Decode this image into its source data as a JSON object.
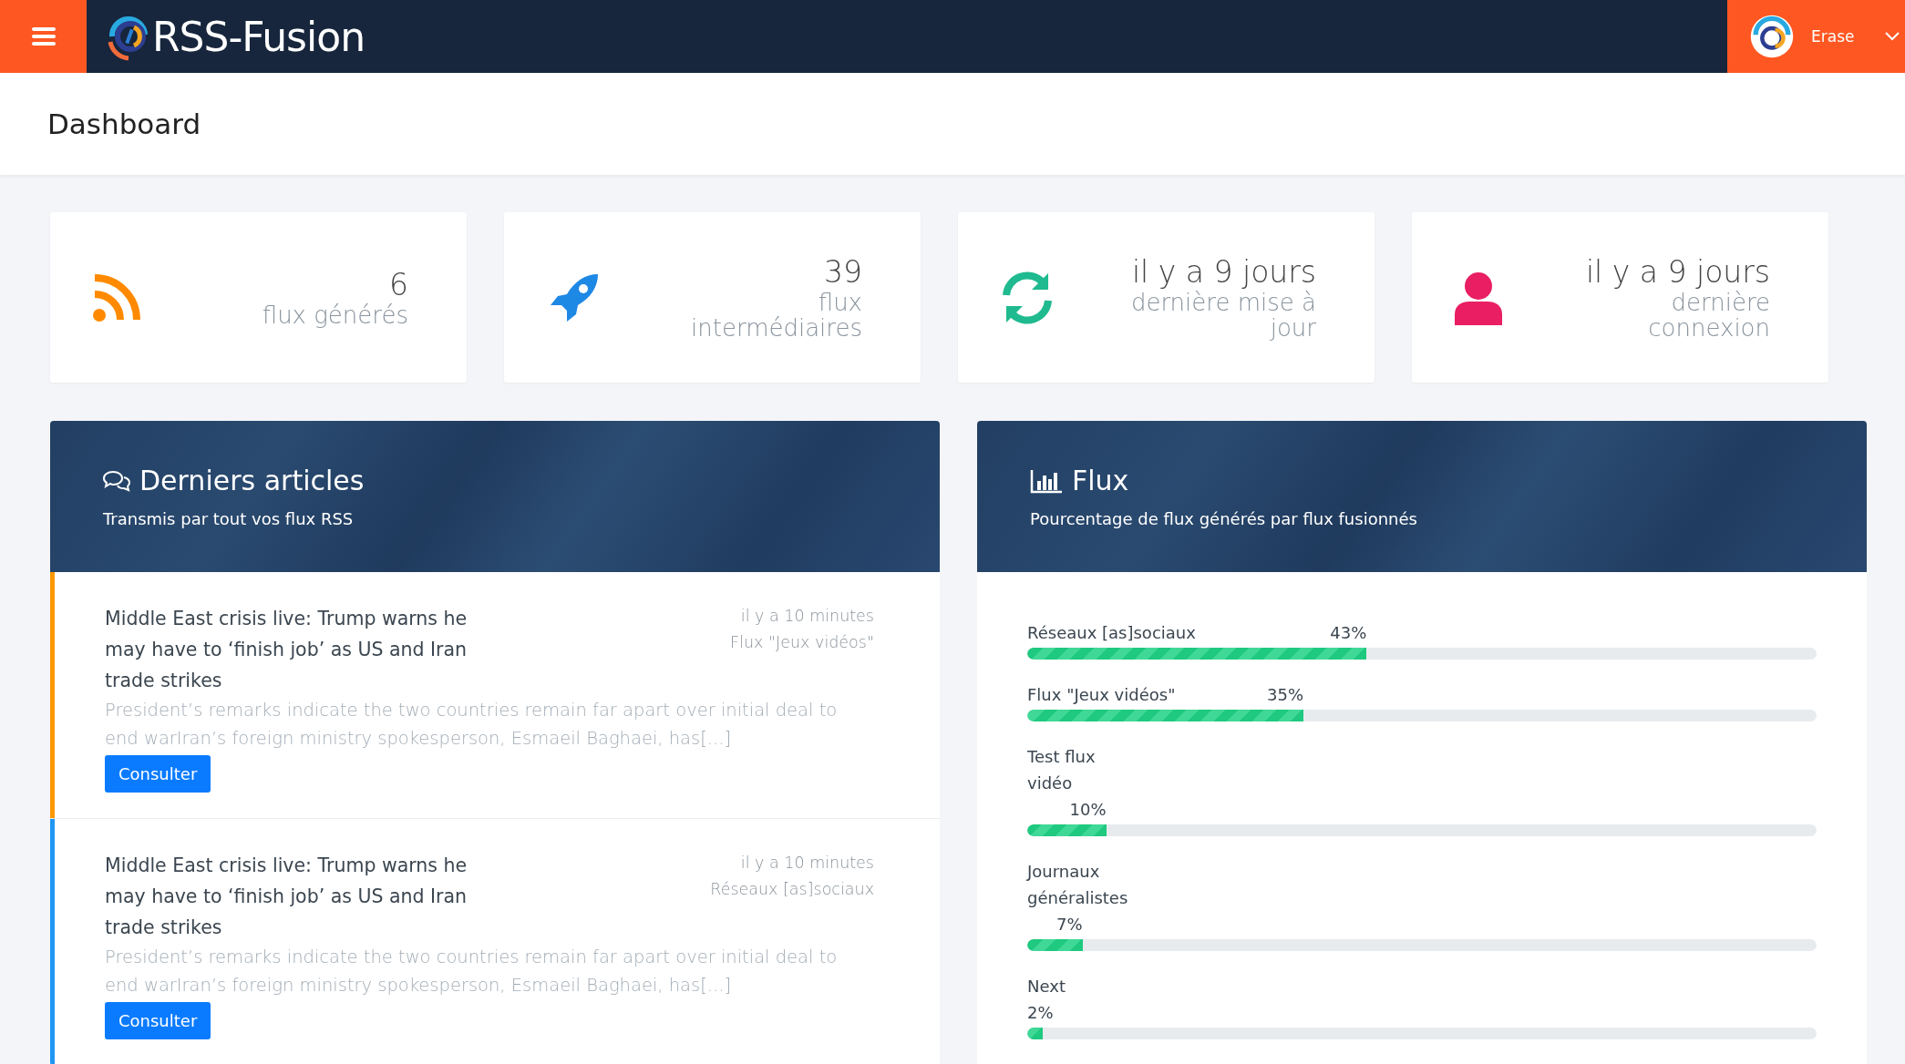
{
  "topbar": {
    "brand": "RSS-Fusion",
    "user": {
      "name": "Erase"
    }
  },
  "page_title": "Dashboard",
  "stats": [
    {
      "kind": "rss",
      "value": "6",
      "label": "flux générés"
    },
    {
      "kind": "rocket",
      "value": "39",
      "label": "flux intermédiaires"
    },
    {
      "kind": "refresh",
      "value": "il y a 9 jours",
      "label": "dernière mise à jour"
    },
    {
      "kind": "user",
      "value": "il y a 9 jours",
      "label": "dernière connexion"
    }
  ],
  "articles_panel": {
    "title": "Derniers articles",
    "subtitle": "Transmis par tout vos flux RSS",
    "articles": [
      {
        "title": "Middle East crisis live: Trump warns he may have to ‘finish job’ as US and Iran trade strikes",
        "time": "il y a 10 minutes",
        "feed": "Flux \"Jeux vidéos\"",
        "excerpt": "President’s remarks indicate the two countries remain far apart over initial deal to end warIran’s foreign ministry spokesperson, Esmaeil Baghaei, has[...]",
        "button": "Consulter",
        "color": "#ff9800"
      },
      {
        "title": "Middle East crisis live: Trump warns he may have to ‘finish job’ as US and Iran trade strikes",
        "time": "il y a 10 minutes",
        "feed": "Réseaux [as]sociaux",
        "excerpt": "President’s remarks indicate the two countries remain far apart over initial deal to end warIran’s foreign ministry spokesperson, Esmaeil Baghaei, has[...]",
        "button": "Consulter",
        "color": "#2196f3"
      }
    ]
  },
  "flux_panel": {
    "title": "Flux",
    "subtitle": "Pourcentage de flux générés par flux fusionnés",
    "bars": [
      {
        "label": "Réseaux [as]sociaux",
        "value": "43%",
        "level": 0.43
      },
      {
        "label": "Flux \"Jeux vidéos\"",
        "value": "35%",
        "level": 0.35
      },
      {
        "label": "Test flux vidéo",
        "value": "10%",
        "level": 0.1
      },
      {
        "label": "Journaux généralistes",
        "value": "7%",
        "level": 0.07
      },
      {
        "label": "Next",
        "value": "2%",
        "level": 0.02
      }
    ]
  }
}
